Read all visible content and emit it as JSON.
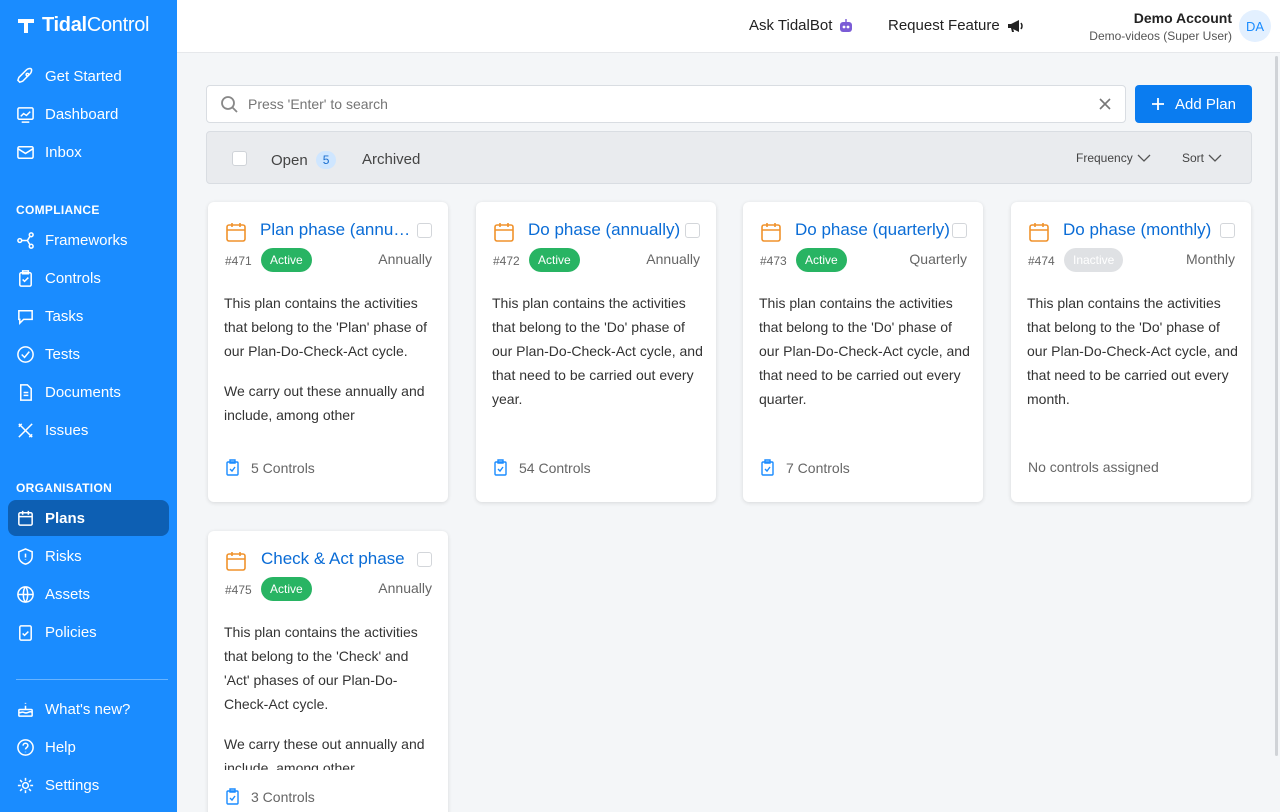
{
  "brand": {
    "name_bold": "Tidal",
    "name_light": "Control"
  },
  "sidebar": {
    "top_items": [
      {
        "label": "Get Started",
        "icon": "rocket-icon"
      },
      {
        "label": "Dashboard",
        "icon": "dashboard-icon"
      },
      {
        "label": "Inbox",
        "icon": "mail-icon"
      }
    ],
    "compliance_title": "COMPLIANCE",
    "compliance_items": [
      {
        "label": "Frameworks",
        "icon": "frameworks-icon"
      },
      {
        "label": "Controls",
        "icon": "controls-icon"
      },
      {
        "label": "Tasks",
        "icon": "tasks-icon"
      },
      {
        "label": "Tests",
        "icon": "tests-icon"
      },
      {
        "label": "Documents",
        "icon": "documents-icon"
      },
      {
        "label": "Issues",
        "icon": "issues-icon"
      }
    ],
    "organisation_title": "ORGANISATION",
    "organisation_items": [
      {
        "label": "Plans",
        "icon": "plans-icon",
        "active": true
      },
      {
        "label": "Risks",
        "icon": "risks-icon"
      },
      {
        "label": "Assets",
        "icon": "assets-icon"
      },
      {
        "label": "Policies",
        "icon": "policies-icon"
      }
    ],
    "bottom_items": [
      {
        "label": "What's new?",
        "icon": "cake-icon"
      },
      {
        "label": "Help",
        "icon": "help-icon"
      },
      {
        "label": "Settings",
        "icon": "settings-icon"
      }
    ]
  },
  "topbar": {
    "ask_label": "Ask TidalBot",
    "request_label": "Request Feature",
    "account_name": "Demo Account",
    "account_role": "Demo-videos (Super User)",
    "avatar_initials": "DA"
  },
  "search": {
    "placeholder": "Press 'Enter' to search"
  },
  "add_button": {
    "label": "Add Plan"
  },
  "filters": {
    "open_label": "Open",
    "open_count": "5",
    "archived_label": "Archived",
    "frequency_label": "Frequency",
    "sort_label": "Sort"
  },
  "colors": {
    "sidebar": "#1a8cff",
    "active_badge": "#28b463",
    "link": "#0a6cd6",
    "calendar": "#f0922b"
  },
  "plans": [
    {
      "title": "Plan phase (annually)",
      "id": "#471",
      "status": "Active",
      "frequency": "Annually",
      "desc1": "This plan contains the activities that belong to the 'Plan' phase of our Plan-Do-Check-Act cycle.",
      "desc2": "We carry out these annually and include, among other",
      "controls": "5 Controls"
    },
    {
      "title": "Do phase (annually)",
      "id": "#472",
      "status": "Active",
      "frequency": "Annually",
      "desc1": "This plan contains the activities that belong to the 'Do' phase of our Plan-Do-Check-Act cycle, and that need to be carried out every year.",
      "desc2": "",
      "controls": "54 Controls"
    },
    {
      "title": "Do phase (quarterly)",
      "id": "#473",
      "status": "Active",
      "frequency": "Quarterly",
      "desc1": "This plan contains the activities that belong to the 'Do' phase of our Plan-Do-Check-Act cycle, and that need to be carried out every quarter.",
      "desc2": "",
      "controls": "7 Controls"
    },
    {
      "title": "Do phase (monthly)",
      "id": "#474",
      "status": "Inactive",
      "frequency": "Monthly",
      "desc1": "This plan contains the activities that belong to the 'Do' phase of our Plan-Do-Check-Act cycle, and that need to be carried out every month.",
      "desc2": "",
      "controls": "No controls assigned"
    },
    {
      "title": "Check & Act phase",
      "id": "#475",
      "status": "Active",
      "frequency": "Annually",
      "desc1": "This plan contains the activities that belong to the 'Check' and 'Act' phases of our Plan-Do-Check-Act cycle.",
      "desc2": "We carry these out annually and include, among other",
      "controls": "3 Controls"
    }
  ]
}
